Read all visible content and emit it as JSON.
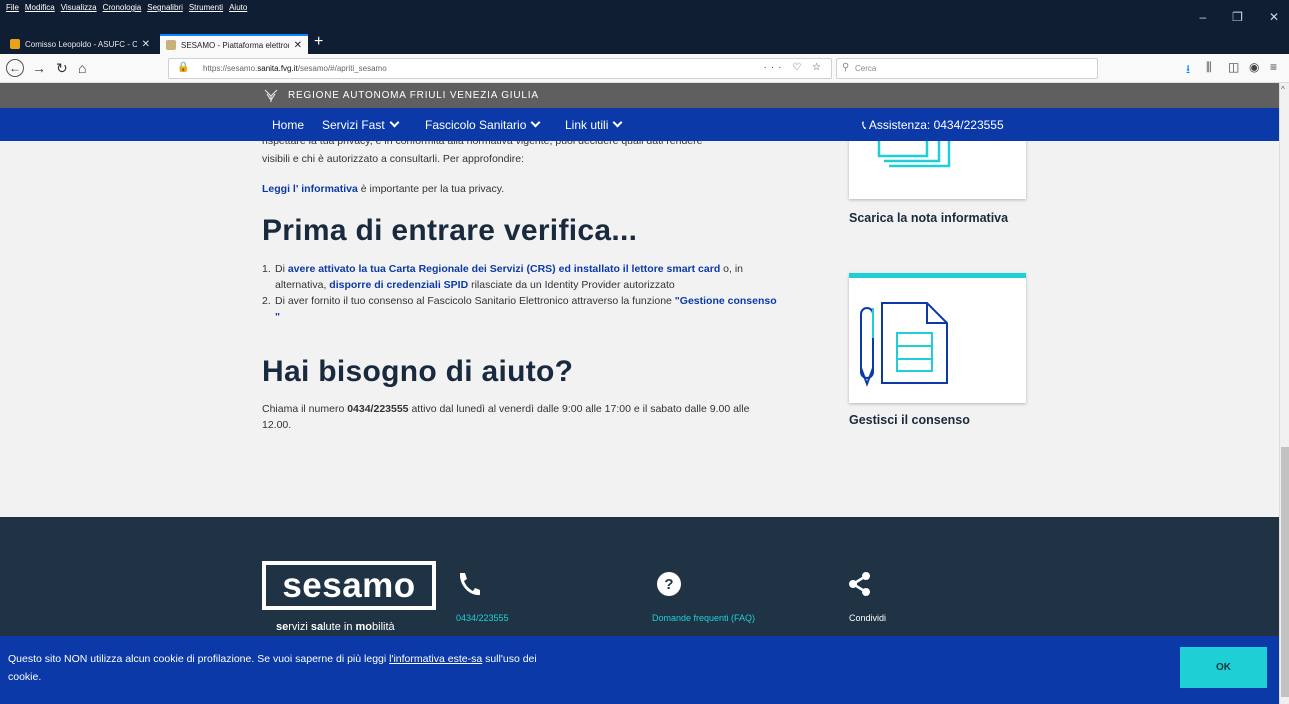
{
  "browser": {
    "menu": [
      "File",
      "Modifica",
      "Visualizza",
      "Cronologia",
      "Segnalibri",
      "Strumenti",
      "Aiuto"
    ],
    "window_controls": [
      "–",
      "❐",
      "✕"
    ],
    "tabs": [
      {
        "title": "Comisso Leopoldo - ASUFC - C",
        "favicon_color": "#e8a21a"
      },
      {
        "title": "SESAMO - Piattaforma elettron",
        "favicon_color": "#c9b27a"
      }
    ],
    "new_tab": "+",
    "url_prefix": "https://sesamo.",
    "url_host": "sanita.fvg.it",
    "url_path": "/sesamo/#/apriti_sesamo",
    "url_trailing_icons": "··· ♡ ☆",
    "search_placeholder": "Cerca"
  },
  "region_bar": {
    "title": "REGIONE AUTONOMA FRIULI VENEZIA GIULIA"
  },
  "nav": {
    "home": "Home",
    "servizi_fast": "Servizi Fast",
    "fascicolo": "Fascicolo Sanitario",
    "link_utili": "Link utili",
    "assistenza": "Assistenza: 0434/223555"
  },
  "intro": {
    "cut_line": "rispettare la tua privacy, e in conformità alla normativa vigente, puoi decidere quali dati rendere",
    "line2": "visibili e chi è autorizzato a consultarli. Per approfondire:",
    "link": "Leggi l' informativa",
    "after_link": " è importante per la tua privacy."
  },
  "verifica": {
    "heading": "Prima di entrare verifica...",
    "step1_num": "1.",
    "step1_a": "Di ",
    "step1_link1": "avere attivato la tua Carta Regionale dei Servizi (CRS) ed installato il lettore smart card",
    "step1_b": " o, in alternativa, ",
    "step1_link2": "disporre di credenziali SPID",
    "step1_c": " rilasciate da un Identity Provider autorizzato",
    "step2_num": "2.",
    "step2_a": "Di aver fornito il tuo consenso al Fascicolo Sanitario Elettronico attraverso la funzione ",
    "step2_link": "\"Gestione consenso \""
  },
  "aiuto": {
    "heading": "Hai bisogno di aiuto?",
    "text_a": "Chiama il numero ",
    "phone": "0434/223555",
    "text_b": " attivo dal lunedì al venerdì dalle 9:00 alle 17:00 e il sabato dalle 9.00 alle 12.00."
  },
  "cards": [
    {
      "title": "Scarica la nota informativa",
      "icon": "documents-icon"
    },
    {
      "title": "Gestisci il consenso",
      "icon": "pencil-form-icon"
    }
  ],
  "footer": {
    "logo": "sesamo",
    "tagline_parts": [
      "se",
      "rvizi ",
      "sa",
      "lute in ",
      "mo",
      "bilità"
    ],
    "phone": "0434/223555",
    "faq": "Domande frequenti (FAQ)",
    "share": "Condividi"
  },
  "cookie": {
    "text": "Questo sito NON utilizza alcun cookie di profilazione. Se vuoi saperne di più leggi ",
    "link": "l'informativa este-sa",
    "after": " sull'uso dei cookie.",
    "ok": "OK"
  },
  "colors": {
    "brand_blue": "#0b3aa8",
    "accent_cyan": "#1ed0d6",
    "footer_bg": "#1f3344"
  }
}
